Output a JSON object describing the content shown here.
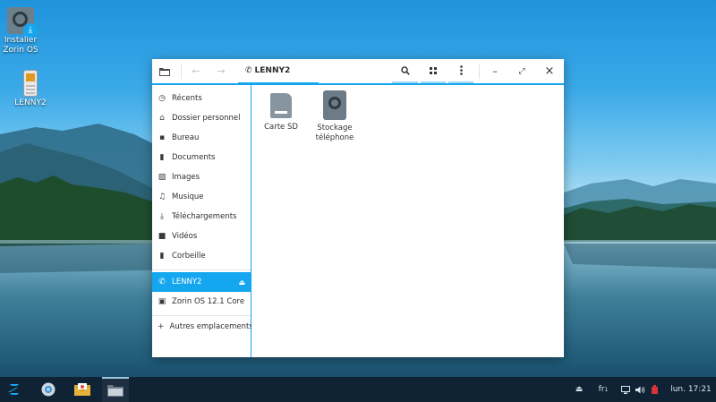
{
  "desktop": {
    "icons": [
      {
        "label": "Installer Zorin OS",
        "icon": "installer-disc-icon"
      },
      {
        "label": "LENNY2",
        "icon": "phone-device-icon"
      }
    ]
  },
  "window": {
    "title": "LENNY2",
    "headerbar": {
      "files_icon": "folder-icon",
      "back_icon": "arrow-left-icon",
      "forward_icon": "arrow-right-icon",
      "path_label": "LENNY2",
      "path_icon": "phone-icon",
      "search_icon": "search-icon",
      "view_icon": "grid-view-icon",
      "menu_icon": "kebab-menu-icon",
      "minimize_glyph": "–",
      "maximize_glyph": "⤢",
      "close_glyph": "×"
    },
    "sidebar": {
      "items": [
        {
          "label": "Récents",
          "icon": "clock-icon",
          "glyph": "◷"
        },
        {
          "label": "Dossier personnel",
          "icon": "home-icon",
          "glyph": "⌂"
        },
        {
          "label": "Bureau",
          "icon": "desktop-icon",
          "glyph": "▪"
        },
        {
          "label": "Documents",
          "icon": "document-icon",
          "glyph": "▮"
        },
        {
          "label": "Images",
          "icon": "image-icon",
          "glyph": "▨"
        },
        {
          "label": "Musique",
          "icon": "music-icon",
          "glyph": "♫"
        },
        {
          "label": "Téléchargements",
          "icon": "download-icon",
          "glyph": "⤓"
        },
        {
          "label": "Vidéos",
          "icon": "video-icon",
          "glyph": "■"
        },
        {
          "label": "Corbeille",
          "icon": "trash-icon",
          "glyph": "▮"
        }
      ],
      "devices": [
        {
          "label": "LENNY2",
          "icon": "phone-icon",
          "glyph": "✆",
          "active": true,
          "eject": "⏏"
        },
        {
          "label": "Zorin OS 12.1 Core",
          "icon": "drive-icon",
          "glyph": "▣"
        }
      ],
      "other": {
        "label": "Autres emplacements",
        "icon": "plus-icon",
        "glyph": "+"
      }
    },
    "files": [
      {
        "label": "Carte SD",
        "icon": "sd-card-icon"
      },
      {
        "label": "Stockage téléphone",
        "icon": "phone-storage-icon"
      }
    ]
  },
  "taskbar": {
    "items": [
      {
        "icon": "zorin-menu-icon"
      },
      {
        "icon": "browser-icon"
      },
      {
        "icon": "mail-icon"
      },
      {
        "icon": "files-icon",
        "active": true
      }
    ],
    "tray": {
      "eject_icon": "eject-icon",
      "keyboard_layout": "fr",
      "keyboard_sub": "1",
      "screen_icon": "display-icon",
      "volume_icon": "volume-icon",
      "power_icon": "power-icon",
      "clock": "lun. 17:21"
    }
  },
  "colors": {
    "accent": "#15a6f0",
    "taskbar": "#0f2335"
  }
}
